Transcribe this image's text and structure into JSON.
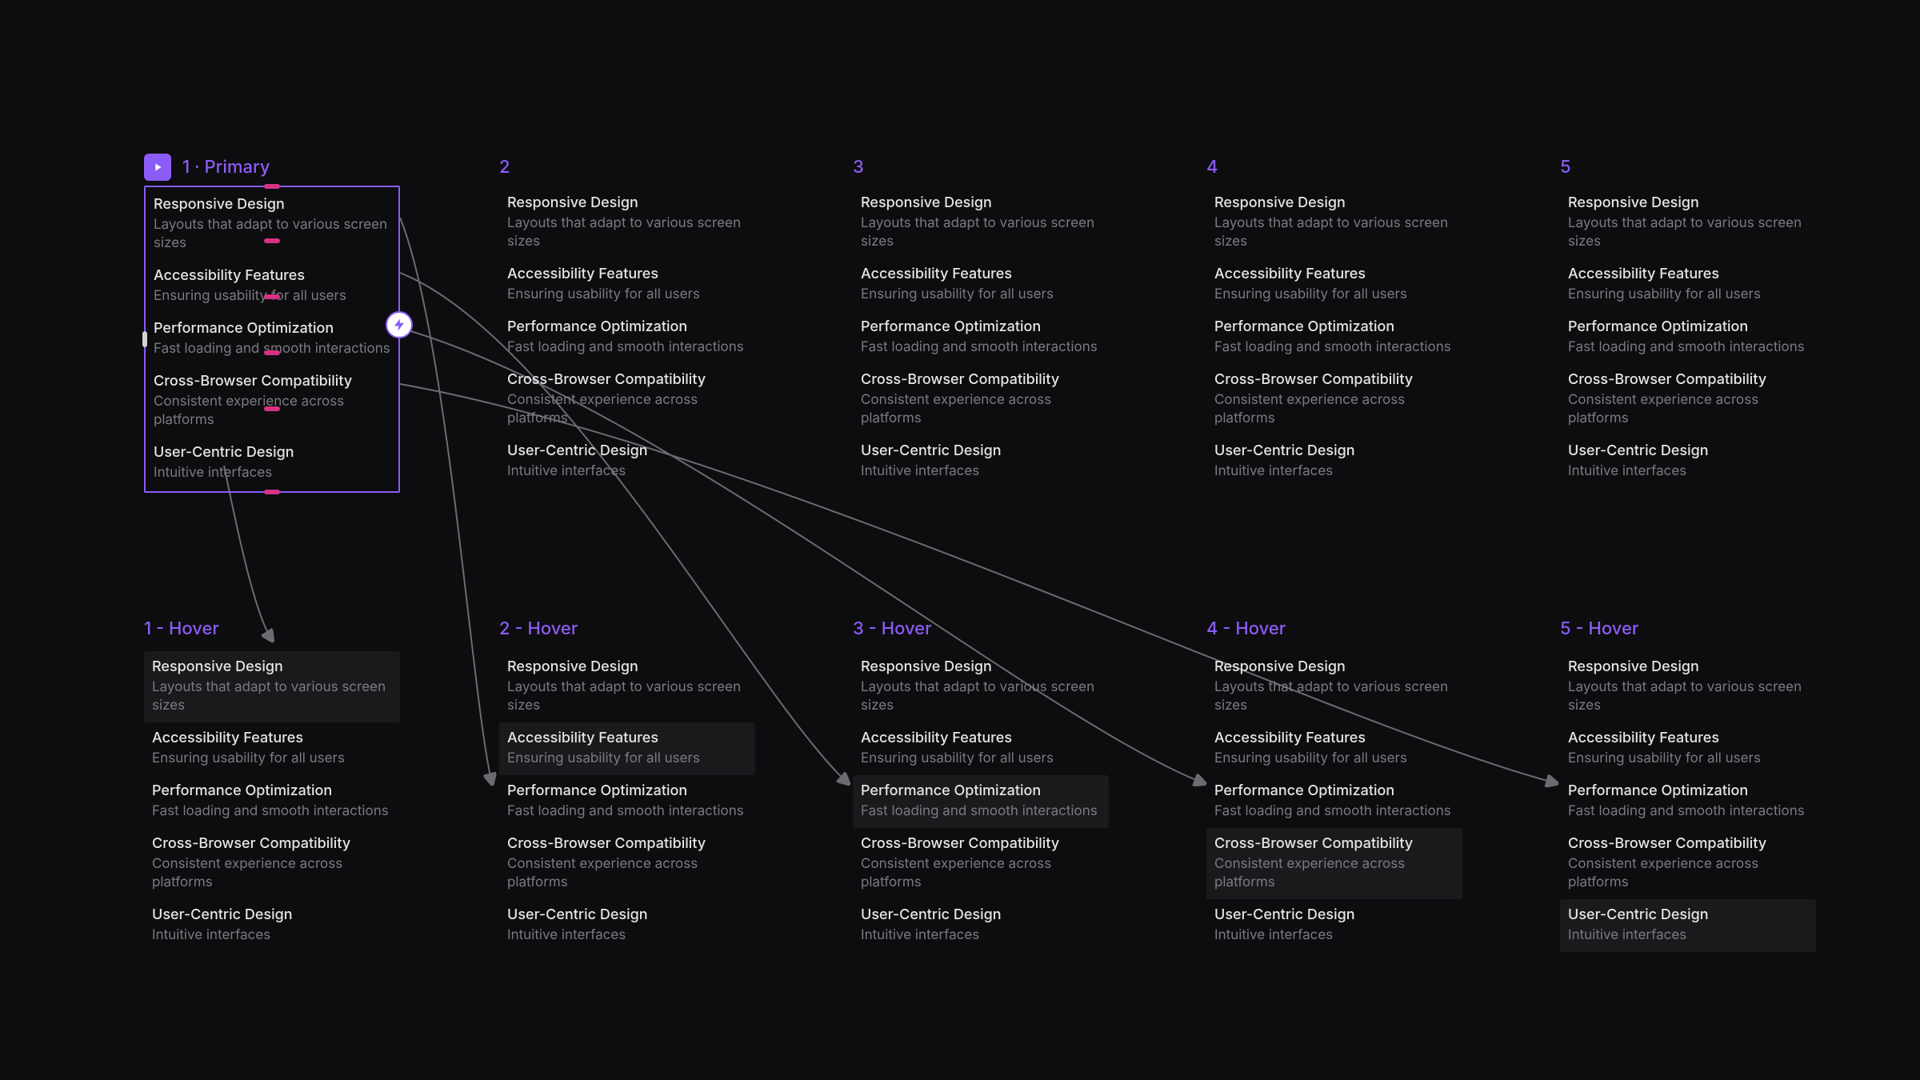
{
  "colors": {
    "accent": "#8b5cf6",
    "handle": "#d63384",
    "connector": "#6b6b70"
  },
  "items": [
    {
      "title": "Responsive Design",
      "desc": "Layouts that adapt to various screen sizes"
    },
    {
      "title": "Accessibility Features",
      "desc": "Ensuring usability for all users"
    },
    {
      "title": "Performance Optimization",
      "desc": "Fast loading and smooth interactions"
    },
    {
      "title": "Cross-Browser Compatibility",
      "desc": "Consistent experience across platforms"
    },
    {
      "title": "User-Centric Design",
      "desc": "Intuitive interfaces"
    }
  ],
  "variants": {
    "top": [
      {
        "label": "1 · Primary",
        "selected": true,
        "hoveredIndex": null,
        "showPlayBadge": true
      },
      {
        "label": "2",
        "selected": false,
        "hoveredIndex": null,
        "showPlayBadge": false
      },
      {
        "label": "3",
        "selected": false,
        "hoveredIndex": null,
        "showPlayBadge": false
      },
      {
        "label": "4",
        "selected": false,
        "hoveredIndex": null,
        "showPlayBadge": false
      },
      {
        "label": "5",
        "selected": false,
        "hoveredIndex": null,
        "showPlayBadge": false
      }
    ],
    "bottom": [
      {
        "label": "1 - Hover",
        "selected": false,
        "hoveredIndex": 0
      },
      {
        "label": "2 - Hover",
        "selected": false,
        "hoveredIndex": 1
      },
      {
        "label": "3 - Hover",
        "selected": false,
        "hoveredIndex": 2
      },
      {
        "label": "4 - Hover",
        "selected": false,
        "hoveredIndex": 3
      },
      {
        "label": "5 - Hover",
        "selected": false,
        "hoveredIndex": 4
      }
    ]
  },
  "interactionBadge": {
    "icon": "bolt"
  }
}
